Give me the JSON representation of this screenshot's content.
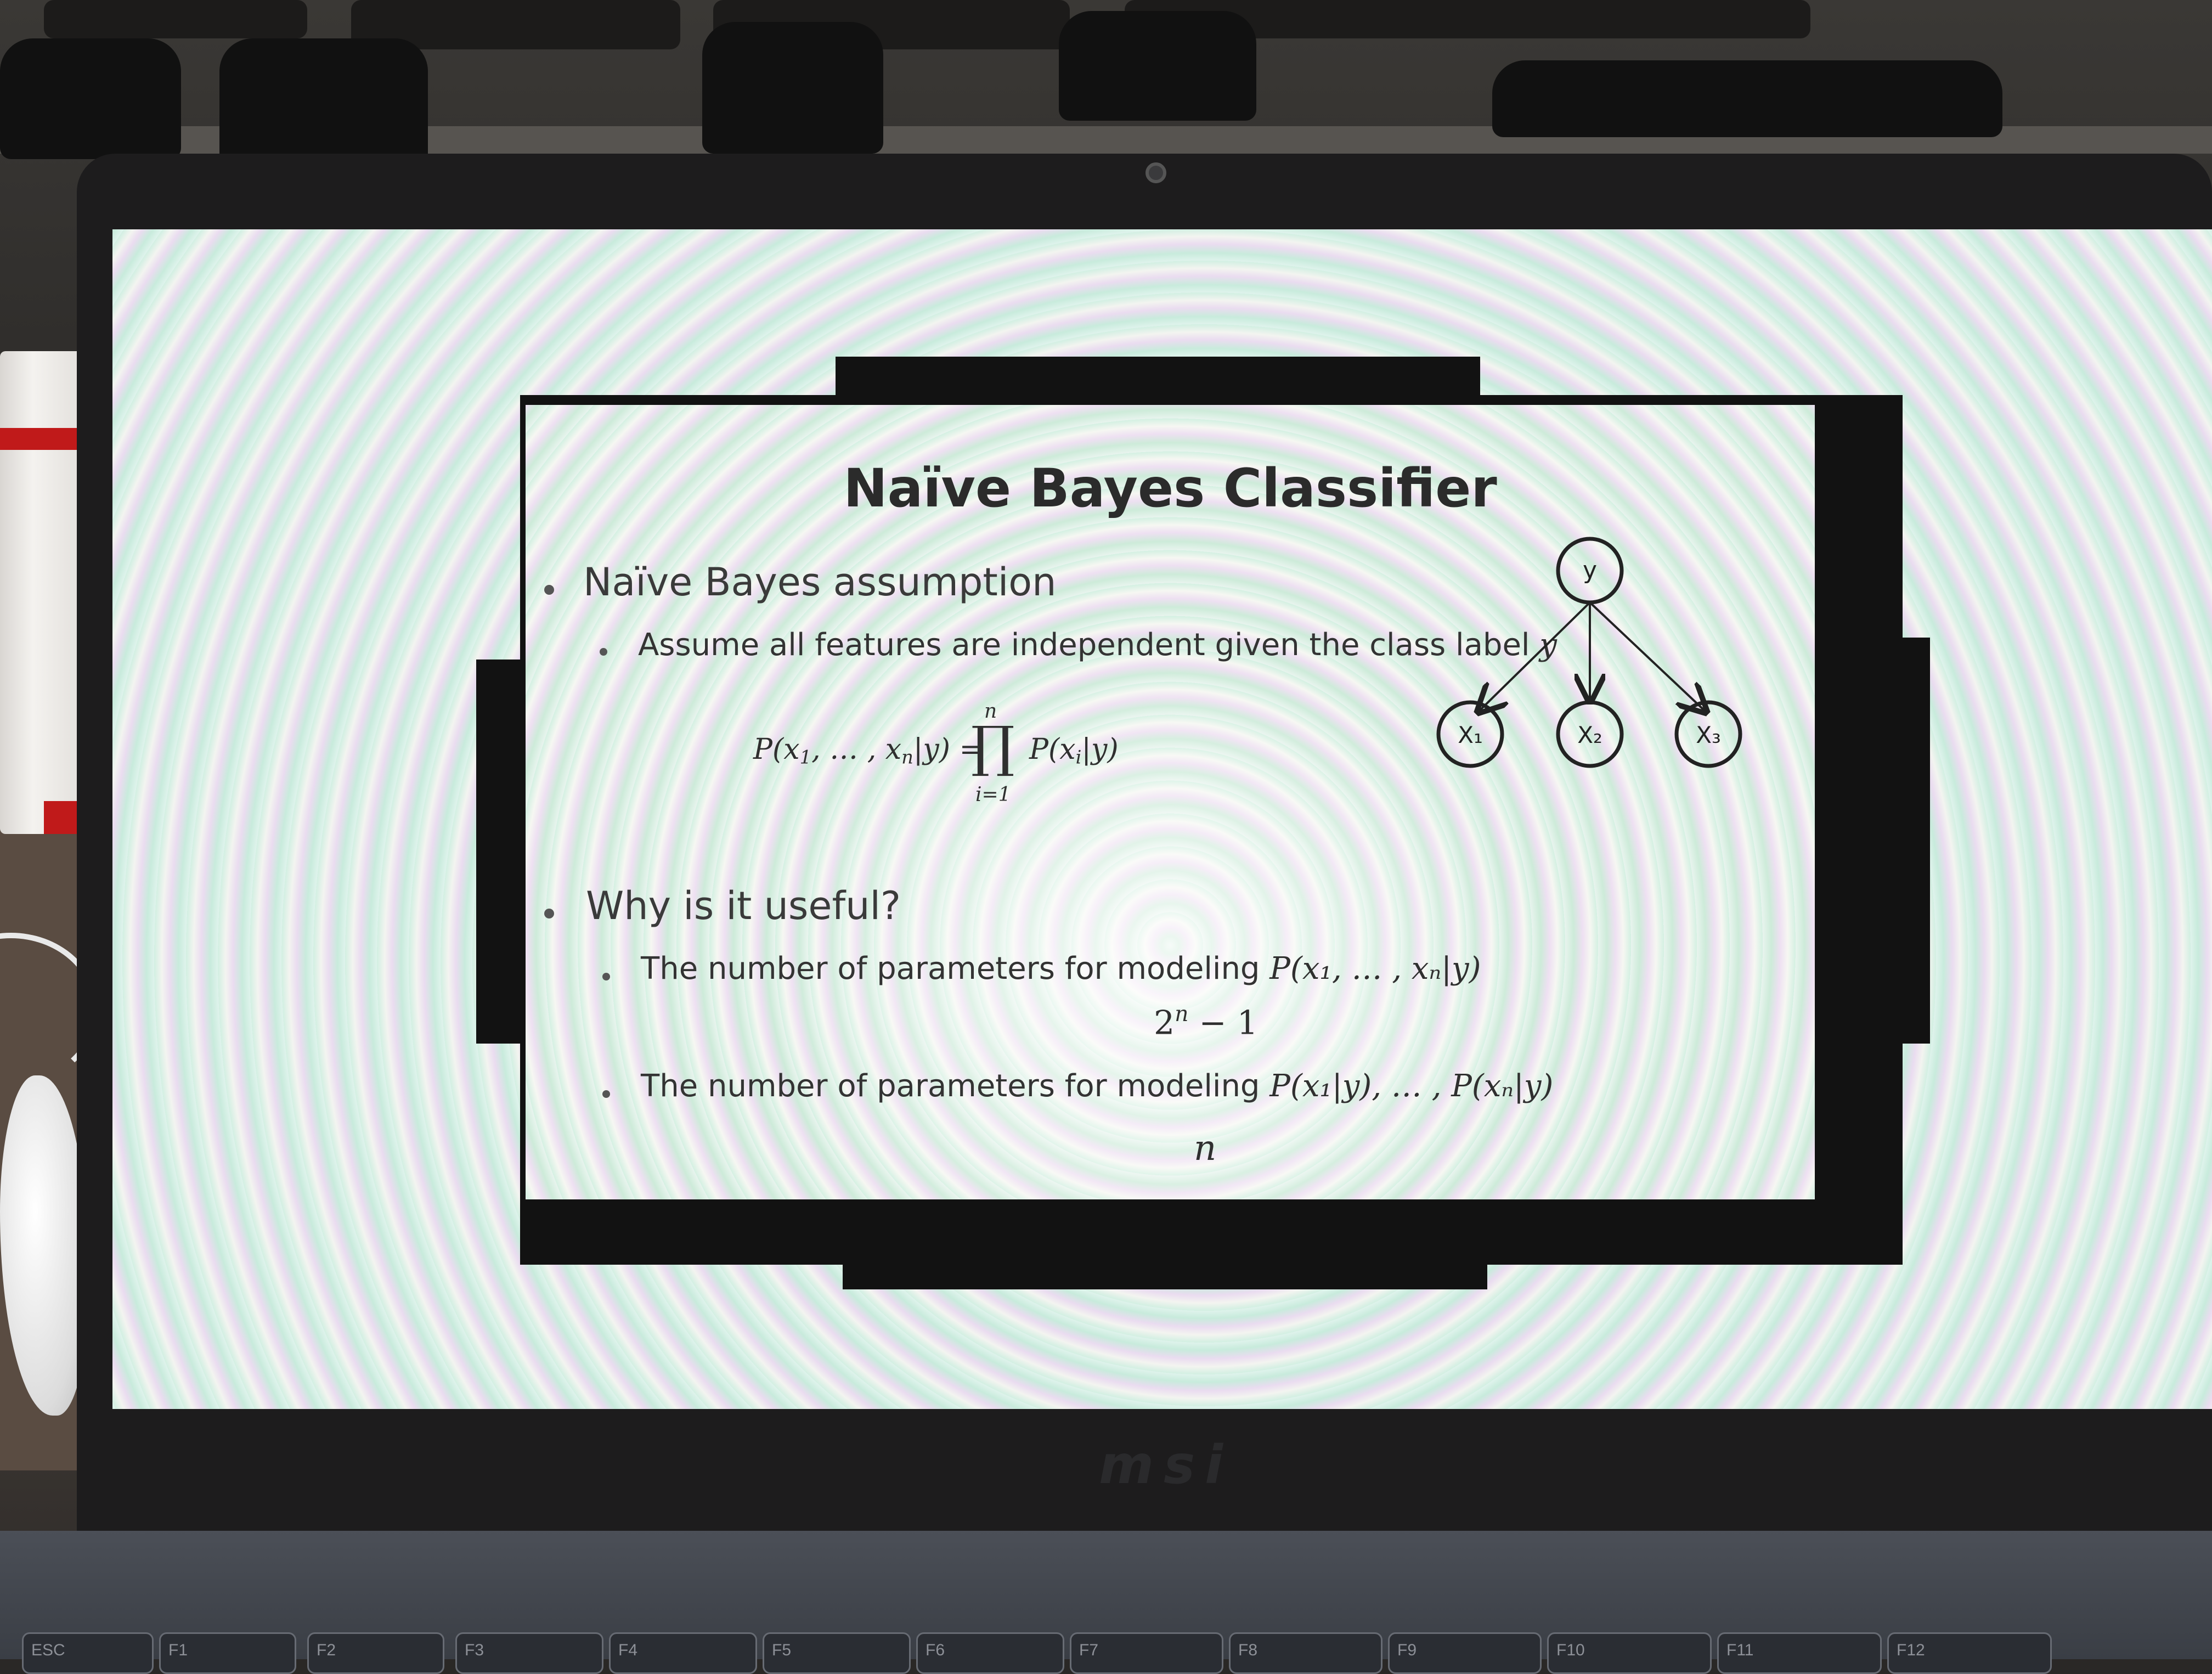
{
  "slide": {
    "title": "Naïve Bayes Classifier",
    "bullet1": "Naïve Bayes assumption",
    "bullet1_sub": "Assume all features are independent given the class label",
    "bullet1_sub_var": "y",
    "formula_lhs": "P(x",
    "formula_lhs_sub1": "1",
    "formula_lhs_mid": ", … , x",
    "formula_lhs_sub2": "n",
    "formula_lhs_end": "|y) =",
    "product_upper": "n",
    "product_symbol": "∏",
    "product_lower": "i=1",
    "formula_rhs": "P(x",
    "formula_rhs_sub": "i",
    "formula_rhs_end": "|y)",
    "bullet2": "Why is it useful?",
    "bullet2_sub1": "The number of parameters for modeling",
    "bullet2_sub1_math": "P(x₁, … , xₙ|y)",
    "value1_base": "2",
    "value1_exp": "n",
    "value1_rest": " − 1",
    "bullet2_sub2": "The number of parameters for modeling",
    "bullet2_sub2_math": "P(x₁|y), … , P(xₙ|y)",
    "value2": "n",
    "graph": {
      "root": "y",
      "children": [
        "X₁",
        "X₂",
        "X₃"
      ]
    }
  },
  "laptop": {
    "brand": "msi",
    "keys": [
      "ESC",
      "F1",
      "F2",
      "F3",
      "F4",
      "F5",
      "F6",
      "F7",
      "F8",
      "F9",
      "F10",
      "F11",
      "F12"
    ]
  },
  "colors": {
    "screen_pattern_green": "#c8ebdc",
    "screen_pattern_pink": "#eadcf0",
    "frame_black": "#121212",
    "cup_red": "#c01a1a"
  }
}
